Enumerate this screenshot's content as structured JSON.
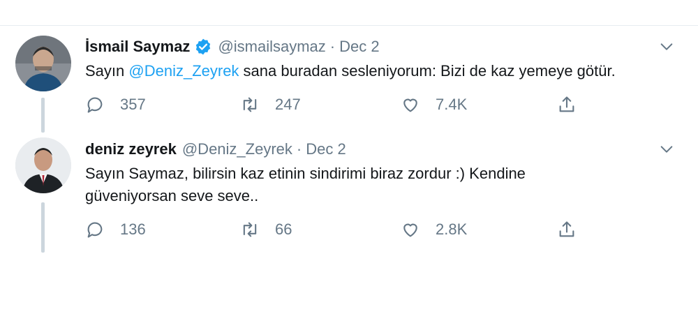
{
  "tweets": [
    {
      "name": "İsmail Saymaz",
      "verified": true,
      "handle": "@ismailsaymaz",
      "separator": "·",
      "date": "Dec 2",
      "text_prefix": "Sayın ",
      "mention": "@Deniz_Zeyrek",
      "text_suffix": " sana buradan sesleniyorum: Bizi de kaz yemeye götür.",
      "replies": "357",
      "retweets": "247",
      "likes": "7.4K"
    },
    {
      "name": "deniz zeyrek",
      "verified": false,
      "handle": "@Deniz_Zeyrek",
      "separator": "·",
      "date": "Dec 2",
      "text_line1": "Sayın Saymaz, bilirsin kaz etinin sindirimi biraz zordur :) Kendine",
      "text_line2": "güveniyorsan seve seve..",
      "replies": "136",
      "retweets": "66",
      "likes": "2.8K"
    }
  ],
  "icons": {
    "reply": "reply-icon",
    "retweet": "retweet-icon",
    "like": "heart-icon",
    "share": "share-icon",
    "verified": "verified-badge-icon",
    "chevron": "chevron-down-icon"
  },
  "colors": {
    "link": "#1da1f2",
    "secondary": "#657786",
    "thread_line": "#ccd6dd"
  }
}
